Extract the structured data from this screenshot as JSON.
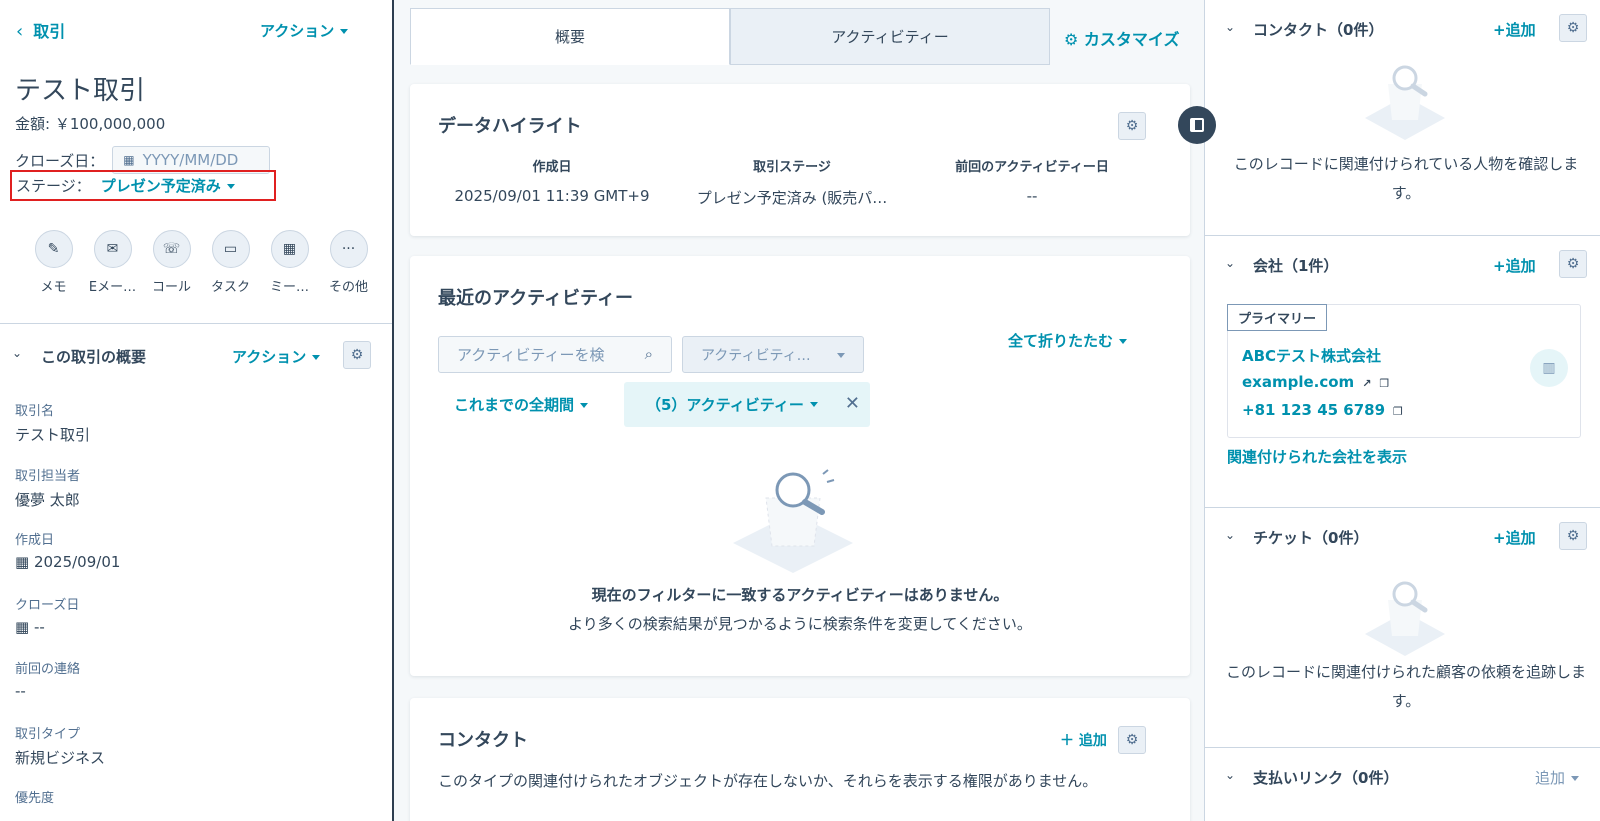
{
  "left": {
    "back_label": "取引",
    "actions_label": "アクション",
    "record_title": "テスト取引",
    "amount": "金額: ￥100,000,000",
    "close_label": "クローズ日：",
    "close_placeholder": "YYYY/MM/DD",
    "stage_label": "ステージ：",
    "stage_value": "プレゼン予定済み",
    "activity_buttons": [
      {
        "label": "メモ",
        "icon": "edit-icon"
      },
      {
        "label": "Eメー…",
        "icon": "email-icon"
      },
      {
        "label": "コール",
        "icon": "phone-icon"
      },
      {
        "label": "タスク",
        "icon": "task-icon"
      },
      {
        "label": "ミー…",
        "icon": "calendar-icon"
      },
      {
        "label": "その他",
        "icon": "more-icon"
      }
    ],
    "section": {
      "title": "この取引の概要",
      "actions_label": "アクション"
    },
    "properties": [
      {
        "label": "取引名",
        "value": "テスト取引"
      },
      {
        "label": "取引担当者",
        "value": "優夢 太郎"
      },
      {
        "label": "作成日",
        "value": "2025/09/01"
      },
      {
        "label": "クローズ日",
        "value": "--"
      },
      {
        "label": "前回の連絡",
        "value": "--"
      },
      {
        "label": "取引タイプ",
        "value": "新規ビジネス"
      },
      {
        "label": "優先度",
        "value": ""
      }
    ]
  },
  "mid": {
    "tabs": [
      "概要",
      "アクティビティー"
    ],
    "customize_label": "カスタマイズ",
    "highlights": {
      "title": "データハイライト",
      "columns": [
        {
          "label": "作成日",
          "value": "2025/09/01 11:39 GMT+9"
        },
        {
          "label": "取引ステージ",
          "value": "プレゼン予定済み (販売パ…"
        },
        {
          "label": "前回のアクティビティー日",
          "value": "--"
        }
      ]
    },
    "recent": {
      "title": "最近のアクティビティー",
      "search_placeholder": "アクティビティーを検",
      "select_value": "アクティビティ…",
      "collapse_label": "全て折りたたむ",
      "period_label": "これまでの全期間",
      "chip_label": "（5）アクティビティー",
      "empty_title": "現在のフィルターに一致するアクティビティーはありません。",
      "empty_text": "より多くの検索結果が見つかるように検索条件を変更してください。"
    },
    "contacts": {
      "title": "コンタクト",
      "add_label": "追加",
      "message": "このタイプの関連付けられたオブジェクトが存在しないか、それらを表示する権限がありません。"
    }
  },
  "right": {
    "contacts": {
      "title": "コンタクト（0件）",
      "add_label": "+追加",
      "desc": "このレコードに関連付けられている人物を確認します。"
    },
    "companies": {
      "title": "会社（1件）",
      "add_label": "+追加",
      "primary_tag": "プライマリー",
      "name": "ABCテスト株式会社",
      "domain": "example.com",
      "phone": "+81 123 45 6789",
      "view_link": "関連付けられた会社を表示"
    },
    "tickets": {
      "title": "チケット（0件）",
      "add_label": "+追加",
      "desc": "このレコードに関連付けられた顧客の依頼を追跡します。"
    },
    "payment_links": {
      "title": "支払いリンク（0件）",
      "add_label": "追加"
    }
  },
  "colors": {
    "accent": "#0091ae",
    "text": "#33475b",
    "highlight_border": "#e02020"
  }
}
